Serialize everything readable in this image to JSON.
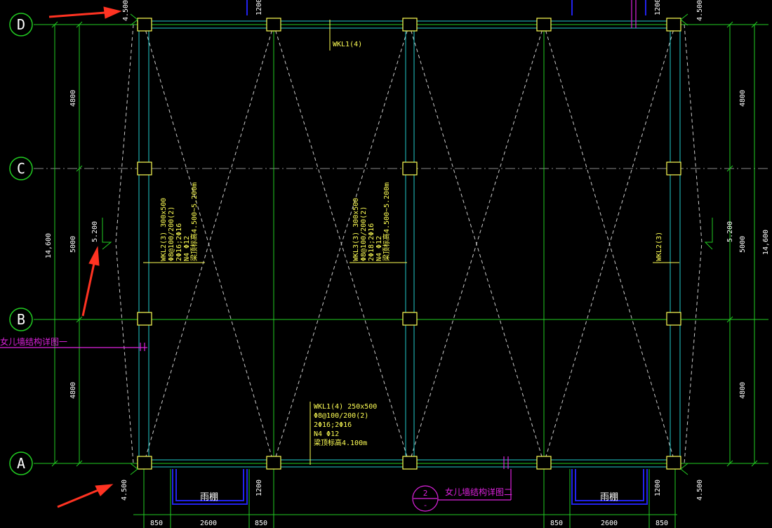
{
  "grid_axes": {
    "D": "D",
    "C": "C",
    "B": "B",
    "A": "A"
  },
  "dims_left": {
    "total": "14,600",
    "d1": "4800",
    "d2": "5000",
    "d3": "4800"
  },
  "dims_right": {
    "total": "14,600",
    "d1": "4800",
    "d2": "5000",
    "d3": "4800"
  },
  "elevations": {
    "top_left": "4.500",
    "top_right": "4.500",
    "mid_left": "5.200",
    "mid_right": "5.200",
    "bottom_left": "4.500",
    "bottom_right": "4.500"
  },
  "bottom_dims": {
    "a": "850",
    "b": "2600",
    "c": "850",
    "d": "850",
    "e": "2600",
    "f": "850",
    "left_1200": "1200",
    "right_1200": "1200",
    "top_left_1200": "1200",
    "top_right_1200": "1200"
  },
  "canopy": {
    "left": "雨棚",
    "right": "雨棚"
  },
  "callouts": {
    "parapet_detail_1": "女儿墙结构详图一",
    "parapet_detail_2": "女儿墙结构详图二",
    "detail_num": "2",
    "detail_sub": "-"
  },
  "beam_top": {
    "line1": "WKL1(4)"
  },
  "beam_left": {
    "line1": "WKL2(3) 300x500",
    "line2": "Φ8@100/200(2)",
    "line3": "2Φ16;2Φ16",
    "line4": "N4 Φ12",
    "line5": "梁顶标高4.500~5.200m"
  },
  "beam_mid": {
    "line1": "WKL3(3) 300x500",
    "line2": "Φ8@100/200(2)",
    "line3": "2Φ18;2Φ16",
    "line4": "N4 Φ12",
    "line5": "梁顶标高4.500~5.200m"
  },
  "beam_right": {
    "line1": "WKL2(3)"
  },
  "beam_bottom": {
    "line1": "WKL1(4) 250x500",
    "line2": "Φ8@100/200(2)",
    "line3": "2Φ16;2Φ16",
    "line4": "N4 Φ12",
    "line5": "梁顶标高4.100m"
  },
  "colors": {
    "grid": "#22dd22",
    "beam": "#22cccc",
    "text_yellow": "#ffff55",
    "magenta": "#dd22dd",
    "blue": "#2222ee",
    "arrow": "#ff3322",
    "white": "#ffffff"
  }
}
